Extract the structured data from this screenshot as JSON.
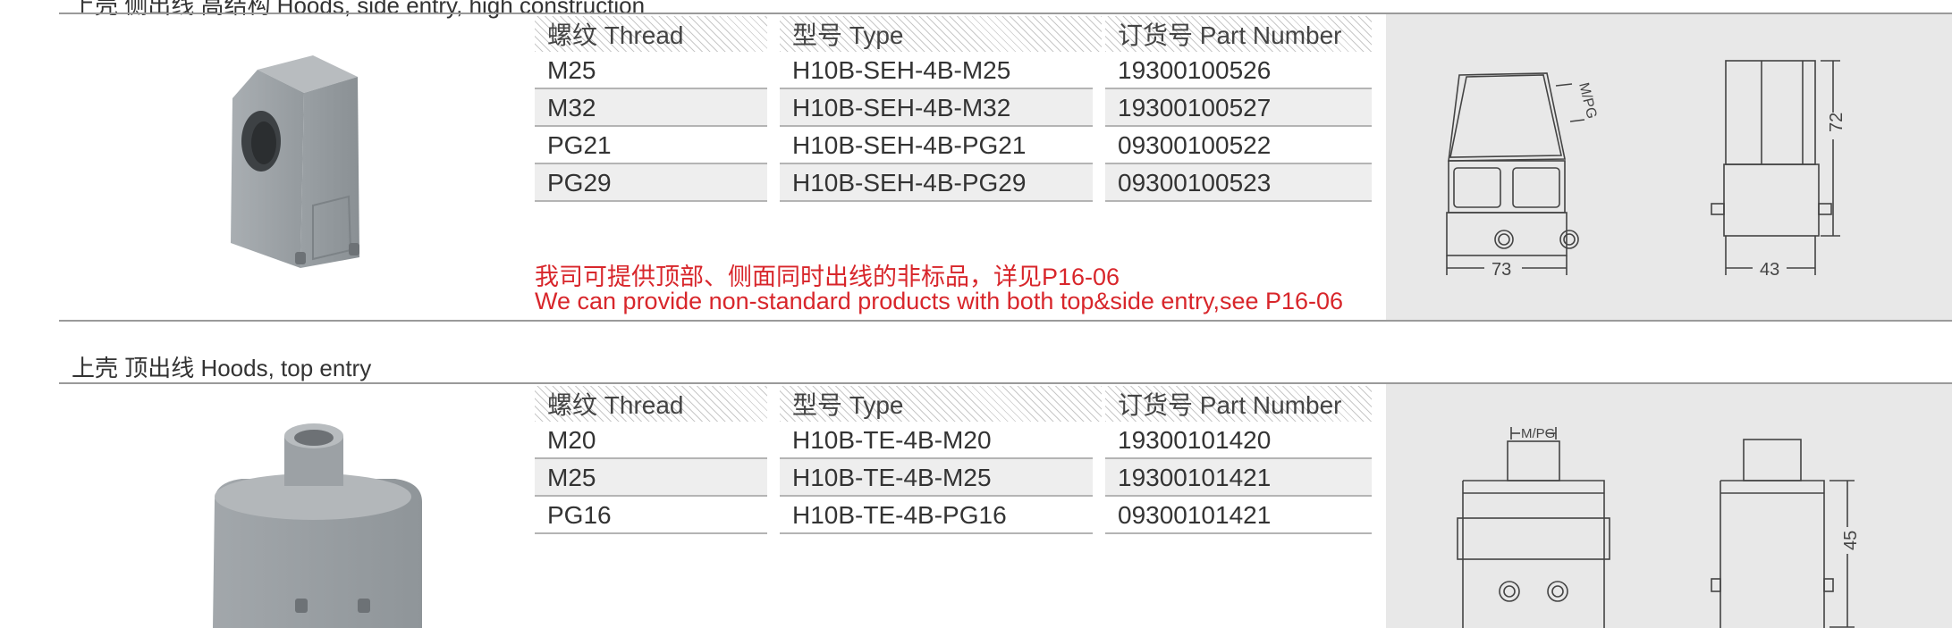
{
  "section1": {
    "title": "上壳 侧出线 高结构 Hoods, side entry, high construction",
    "headers": {
      "thread": "螺纹 Thread",
      "type": "型号 Type",
      "part": "订货号 Part Number"
    },
    "rows": [
      {
        "thread": "M25",
        "type": "H10B-SEH-4B-M25",
        "part": "19300100526"
      },
      {
        "thread": "M32",
        "type": "H10B-SEH-4B-M32",
        "part": "19300100527"
      },
      {
        "thread": "PG21",
        "type": "H10B-SEH-4B-PG21",
        "part": "09300100522"
      },
      {
        "thread": "PG29",
        "type": "H10B-SEH-4B-PG29",
        "part": "09300100523"
      }
    ],
    "note_cn": "我司可提供顶部、侧面同时出线的非标品，详见P16-06",
    "note_en": "We can provide non-standard products with both top&side entry,see P16-06",
    "drawing": {
      "dim_width": "73",
      "dim_depth": "43",
      "dim_height": "72",
      "thread_label": "M/PG"
    }
  },
  "section2": {
    "title": "上壳 顶出线  Hoods, top entry",
    "headers": {
      "thread": "螺纹 Thread",
      "type": "型号 Type",
      "part": "订货号 Part Number"
    },
    "rows": [
      {
        "thread": "M20",
        "type": "H10B-TE-4B-M20",
        "part": "19300101420"
      },
      {
        "thread": "M25",
        "type": "H10B-TE-4B-M25",
        "part": "19300101421"
      },
      {
        "thread": "PG16",
        "type": "H10B-TE-4B-PG16",
        "part": "09300101421"
      }
    ],
    "drawing": {
      "dim_height": "45",
      "thread_label": "M/PG"
    }
  },
  "colors": {
    "note_red": "#d8262b",
    "product_grey": "#8e9397",
    "panel_grey": "#e8e8e8"
  }
}
